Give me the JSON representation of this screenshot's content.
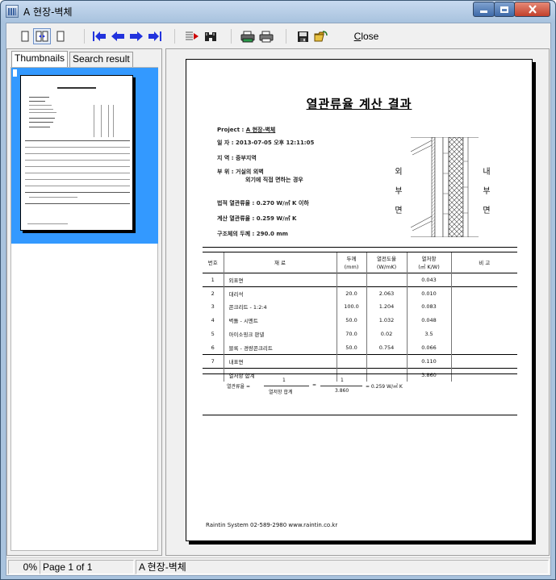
{
  "window": {
    "title": "A 현장-벽체",
    "colors": {
      "titlebar": "#a9c3de",
      "close_button": "#c2402b",
      "selection": "#3399ff",
      "nav_arrows": "#2233dd"
    }
  },
  "toolbar": {
    "close_label": "Close",
    "close_access_key": "C",
    "close_rest": "lose",
    "icons": [
      "single-page-icon",
      "facing-pages-icon",
      "page-width-icon",
      "first-page-icon",
      "prev-page-icon",
      "next-page-icon",
      "last-page-icon",
      "goto-page-icon",
      "find-icon",
      "print-setup-icon",
      "print-icon",
      "save-icon",
      "open-icon"
    ]
  },
  "left_panel": {
    "tabs": [
      {
        "label": "Thumbnails",
        "active": true
      },
      {
        "label": "Search result",
        "active": false
      }
    ]
  },
  "document": {
    "title": "열관류율 계산 결과",
    "project_label": "Project : ",
    "project_value": "A 현장-벽체",
    "date_label": "일    자 : ",
    "date_value": "2013-07-05 오후 12:11:05",
    "region_label": "지    역 : ",
    "region_value": "중부지역",
    "location_label": "부    위 : ",
    "location_value_1": "거실의 외벽",
    "location_value_2": "외기에 직접 면하는 경우",
    "std_label": "법적 열관류율 : ",
    "std_value": "0.270 W/㎡ K 이하",
    "calc_label": "계산 열관류율 : ",
    "calc_value": "0.259 W/㎡ K",
    "thickness_label": "구조체의 두께 : ",
    "thickness_value": "290.0 mm",
    "outside_label": [
      "외",
      "부",
      "면"
    ],
    "inside_label": [
      "내",
      "부",
      "면"
    ],
    "table": {
      "headers": {
        "no": "번호",
        "material": "재          료",
        "thickness": "두께",
        "thickness_unit": "(mm)",
        "conductivity": "열전도율",
        "conductivity_unit": "(W/mK)",
        "resistance": "열저항",
        "resistance_unit": "(㎡ K/W)",
        "remarks": "비     고"
      },
      "rows": [
        {
          "no": "1",
          "material": "외표면",
          "thickness": "",
          "conductivity": "",
          "resistance": "0.043",
          "remarks": ""
        },
        {
          "no": "2",
          "material": "대리석",
          "thickness": "20.0",
          "conductivity": "2.063",
          "resistance": "0.010",
          "remarks": ""
        },
        {
          "no": "3",
          "material": "콘크리트 - 1:2:4",
          "thickness": "100.0",
          "conductivity": "1.204",
          "resistance": "0.083",
          "remarks": ""
        },
        {
          "no": "4",
          "material": "벽돌 - 시멘트",
          "thickness": "50.0",
          "conductivity": "1.032",
          "resistance": "0.048",
          "remarks": ""
        },
        {
          "no": "5",
          "material": "아이소핑크 판넬",
          "thickness": "70.0",
          "conductivity": "0.02",
          "resistance": "3.5",
          "remarks": ""
        },
        {
          "no": "6",
          "material": "블록 - 경량콘크리트",
          "thickness": "50.0",
          "conductivity": "0.754",
          "resistance": "0.066",
          "remarks": ""
        },
        {
          "no": "7",
          "material": "내표면",
          "thickness": "",
          "conductivity": "",
          "resistance": "0.110",
          "remarks": ""
        },
        {
          "no": "",
          "material": "열저항 합계",
          "thickness": "",
          "conductivity": "",
          "resistance": "3.860",
          "remarks": ""
        }
      ]
    },
    "formula": {
      "label": "열관류율 =",
      "num1": "1",
      "den1": "열저항 합계",
      "eq": "=",
      "num2": "1",
      "den2": "3.860",
      "result": "=  0.259 W/㎡ K"
    },
    "footer": "Raintin System   02-589-2980   www.raintin.co.kr"
  },
  "statusbar": {
    "progress": "0%",
    "page_info": "Page 1 of 1",
    "doc_name": "A 현장-벽체"
  }
}
